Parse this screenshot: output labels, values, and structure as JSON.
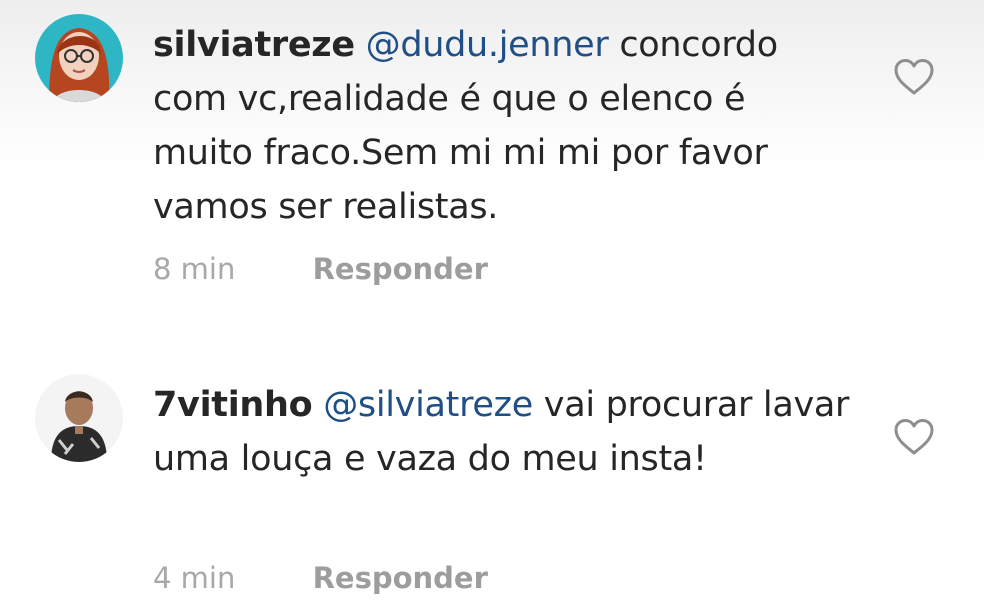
{
  "comments": [
    {
      "username": "silviatreze",
      "mention": "@dudu.jenner",
      "text": " concordo com vc,realidade é que o elenco é muito fraco.Sem mi mi mi por favor vamos ser realistas.",
      "time": "8 min",
      "reply_label": "Responder",
      "like_icon": "heart-outline-icon"
    },
    {
      "username": "7vitinho",
      "mention": "@silviatreze",
      "text": " vai procurar lavar uma louça e vaza do meu insta!",
      "time": "4 min",
      "reply_label": "Responder",
      "like_icon": "heart-outline-icon"
    }
  ],
  "colors": {
    "text": "#262626",
    "mention": "#1f4f86",
    "meta": "#a8a8a8"
  }
}
